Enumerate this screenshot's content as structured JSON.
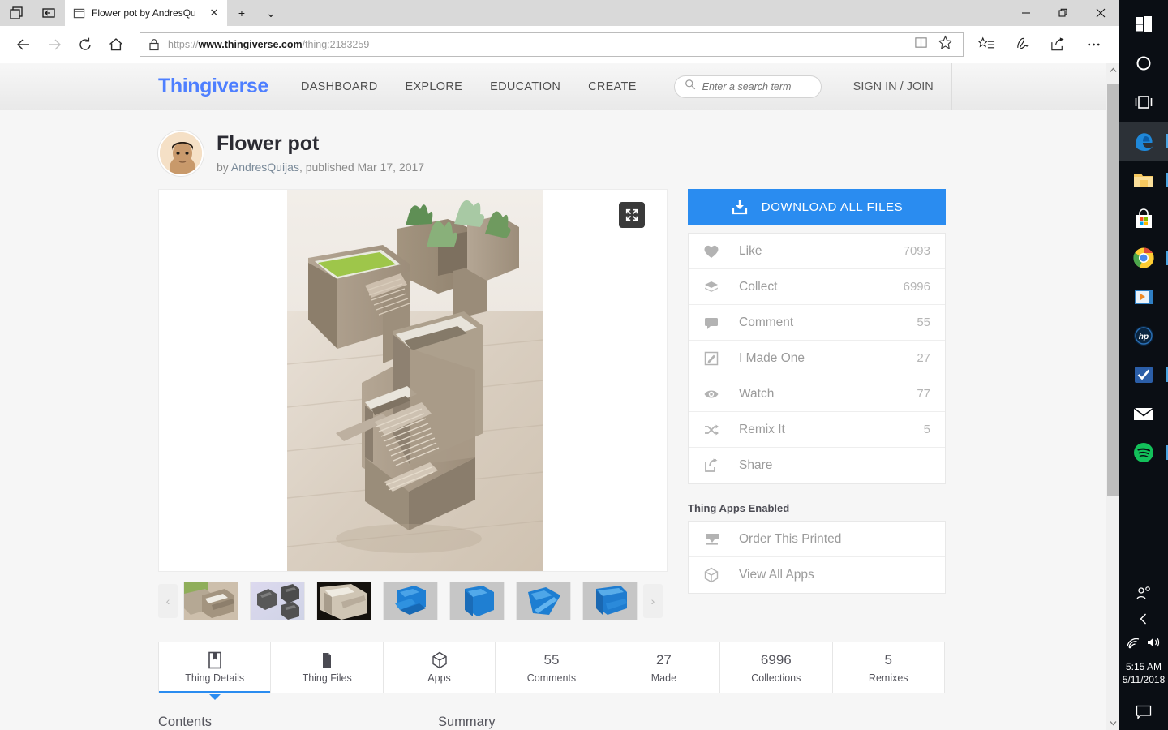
{
  "browser": {
    "tab": {
      "title": "Flower pot by AndresQu",
      "close_label": "✕"
    },
    "new_tab_label": "+",
    "tab_menu_label": "⌄",
    "window_controls": {
      "minimize": "—",
      "restore": "❐",
      "close": "✕"
    },
    "url": {
      "scheme": "https://",
      "host": "www.thingiverse.com",
      "path": "/thing:2183259"
    },
    "toolbar_icons": [
      "hub-icon",
      "notes-icon",
      "share-icon",
      "more-icon"
    ]
  },
  "site": {
    "logo": "Thingiverse",
    "nav": [
      {
        "label": "DASHBOARD"
      },
      {
        "label": "EXPLORE"
      },
      {
        "label": "EDUCATION"
      },
      {
        "label": "CREATE"
      }
    ],
    "search": {
      "placeholder": "Enter a search term",
      "value": ""
    },
    "signin": "SIGN IN / JOIN"
  },
  "thing": {
    "title": "Flower pot",
    "by_prefix": "by ",
    "author": "AndresQuijas",
    "published": ", published Mar 17, 2017"
  },
  "download": {
    "label": "DOWNLOAD ALL FILES"
  },
  "actions": [
    {
      "icon": "heart-icon",
      "label": "Like",
      "count": "7093"
    },
    {
      "icon": "collect-icon",
      "label": "Collect",
      "count": "6996"
    },
    {
      "icon": "comment-icon",
      "label": "Comment",
      "count": "55"
    },
    {
      "icon": "pencil-square-icon",
      "label": "I Made One",
      "count": "27"
    },
    {
      "icon": "eye-icon",
      "label": "Watch",
      "count": "77"
    },
    {
      "icon": "shuffle-icon",
      "label": "Remix It",
      "count": "5"
    },
    {
      "icon": "share-arrow-icon",
      "label": "Share",
      "count": ""
    }
  ],
  "apps": {
    "title": "Thing Apps Enabled",
    "items": [
      {
        "icon": "printer-icon",
        "label": "Order This Printed"
      },
      {
        "icon": "cube-icon",
        "label": "View All Apps"
      }
    ]
  },
  "tabs": [
    {
      "icon": "details-icon",
      "num": "",
      "label": "Thing Details",
      "active": true
    },
    {
      "icon": "files-icon",
      "num": "",
      "label": "Thing Files",
      "active": false
    },
    {
      "icon": "cube-icon",
      "num": "",
      "label": "Apps",
      "active": false
    },
    {
      "icon": "",
      "num": "55",
      "label": "Comments",
      "active": false
    },
    {
      "icon": "",
      "num": "27",
      "label": "Made",
      "active": false
    },
    {
      "icon": "",
      "num": "6996",
      "label": "Collections",
      "active": false
    },
    {
      "icon": "",
      "num": "5",
      "label": "Remixes",
      "active": false
    }
  ],
  "sections": {
    "contents": "Contents",
    "summary": "Summary"
  },
  "gallery": {
    "prev_label": "‹",
    "next_label": "›",
    "thumbs": [
      {
        "name": "thumb-concrete-pots"
      },
      {
        "name": "thumb-gray-render-group"
      },
      {
        "name": "thumb-dark-photo"
      },
      {
        "name": "thumb-blue-render-1"
      },
      {
        "name": "thumb-blue-render-2"
      },
      {
        "name": "thumb-blue-render-3"
      },
      {
        "name": "thumb-blue-render-4"
      }
    ]
  },
  "taskbar": {
    "items": [
      {
        "name": "start-button"
      },
      {
        "name": "cortana-search-icon"
      },
      {
        "name": "task-view-icon"
      },
      {
        "name": "edge-icon"
      },
      {
        "name": "file-explorer-icon"
      },
      {
        "name": "microsoft-store-icon"
      },
      {
        "name": "chrome-icon"
      },
      {
        "name": "movies-tv-icon"
      },
      {
        "name": "hp-icon"
      },
      {
        "name": "checkmark-app-icon"
      },
      {
        "name": "mail-icon"
      },
      {
        "name": "spotify-icon"
      }
    ],
    "tray": {
      "people": "people-icon",
      "show_hidden": "chevron-up-icon",
      "wifi": "wifi-icon",
      "volume": "volume-icon",
      "time": "5:15 AM",
      "date": "5/11/2018",
      "action_center": "notification-icon"
    }
  },
  "colors": {
    "accent_blue": "#2a8cf0",
    "logo_blue": "#4e7fff",
    "page_bg": "#f6f6f6",
    "taskbar_bg": "#0a0e14"
  }
}
